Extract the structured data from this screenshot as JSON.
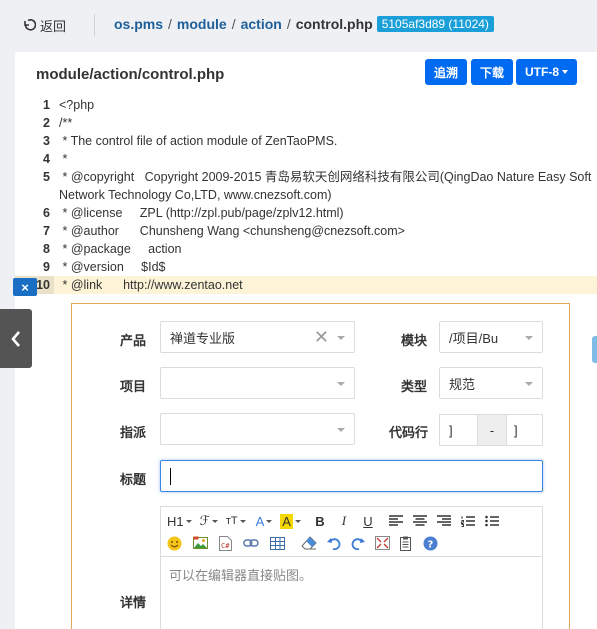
{
  "topbar": {
    "back_label": "返回",
    "breadcrumb": [
      "os.pms",
      "module",
      "action",
      "control.php"
    ],
    "revision_badge": "5105af3d89 (11024)"
  },
  "panel": {
    "title": "module/action/control.php",
    "blame_label": "追溯",
    "download_label": "下载",
    "encoding_label": "UTF-8"
  },
  "code_lines": [
    {
      "num": "1",
      "text": "<?php"
    },
    {
      "num": "2",
      "text": "/**"
    },
    {
      "num": "3",
      "text": " * The control file of action module of ZenTaoPMS."
    },
    {
      "num": "4",
      "text": " *"
    },
    {
      "num": "5",
      "text": " * @copyright   Copyright 2009-2015 青岛易软天创网络科技有限公司(QingDao Nature Easy Soft Network Technology Co,LTD, www.cnezsoft.com)"
    },
    {
      "num": "6",
      "text": " * @license     ZPL (http://zpl.pub/page/zplv12.html)"
    },
    {
      "num": "7",
      "text": " * @author      Chunsheng Wang <chunsheng@cnezsoft.com>"
    },
    {
      "num": "8",
      "text": " * @package     action"
    },
    {
      "num": "9",
      "text": " * @version     $Id$"
    },
    {
      "num": "10",
      "text": " * @link      http://www.zentao.net"
    }
  ],
  "close_symbol": "×",
  "form": {
    "product_label": "产品",
    "product_value": "禅道专业版",
    "module_label": "模块",
    "module_value": "/项目/Bu",
    "project_label": "项目",
    "project_value": "",
    "type_label": "类型",
    "type_value": "规范",
    "assign_label": "指派",
    "assign_value": "",
    "codeline_label": "代码行",
    "codeline_start": "]",
    "codeline_sep": "-",
    "codeline_end": "]",
    "title_label": "标题",
    "title_value": "",
    "detail_label": "详情",
    "editor_placeholder": "可以在编辑器直接贴图。"
  },
  "toolbar": {
    "heading": "H1",
    "font_family": "ℱ",
    "font_size": "тT",
    "font_color": "A",
    "bg_color": "A",
    "bold": "B",
    "italic": "I",
    "underline": "U"
  },
  "colors": {
    "accent": "#006af1",
    "badge": "#1a9fd9",
    "highlight_line": "#fdf4d8",
    "form_border": "#e0a85b"
  }
}
